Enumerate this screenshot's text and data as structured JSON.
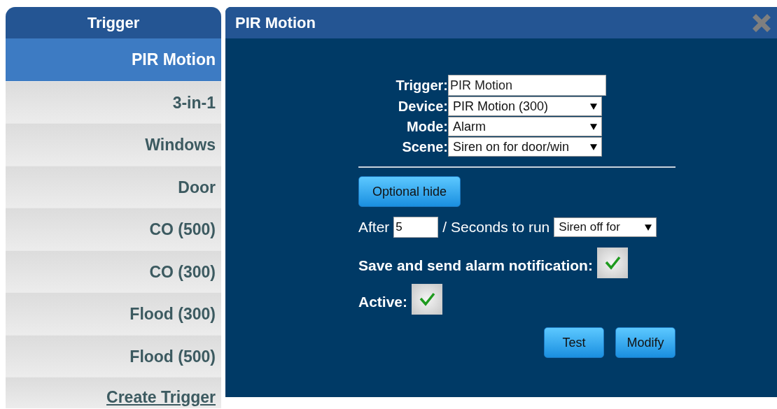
{
  "sidebar": {
    "title": "Trigger",
    "items": [
      {
        "label": "PIR Motion",
        "selected": true
      },
      {
        "label": "3-in-1",
        "selected": false
      },
      {
        "label": "Windows",
        "selected": false
      },
      {
        "label": "Door",
        "selected": false
      },
      {
        "label": "CO (500)",
        "selected": false
      },
      {
        "label": "CO (300)",
        "selected": false
      },
      {
        "label": "Flood (300)",
        "selected": false
      },
      {
        "label": "Flood (500)",
        "selected": false
      }
    ],
    "create_link": "Create Trigger"
  },
  "dialog": {
    "title": "PIR Motion",
    "fields": [
      {
        "label": "Trigger:",
        "kind": "text",
        "value": "PIR Motion"
      },
      {
        "label": "Device:",
        "kind": "select",
        "value": "PIR Motion (300)"
      },
      {
        "label": "Mode:",
        "kind": "select",
        "value": "Alarm"
      },
      {
        "label": "Scene:",
        "kind": "select",
        "value": "Siren on for door/win"
      }
    ],
    "optional_button": "Optional hide",
    "after": {
      "label": "After",
      "value": "5",
      "suffix": "/ Seconds to run",
      "select_value": "Siren off for"
    },
    "checks": [
      {
        "label": "Save and send alarm notification:",
        "checked": true
      },
      {
        "label": "Active:",
        "checked": true
      }
    ],
    "buttons": [
      "Test",
      "Modify"
    ]
  }
}
